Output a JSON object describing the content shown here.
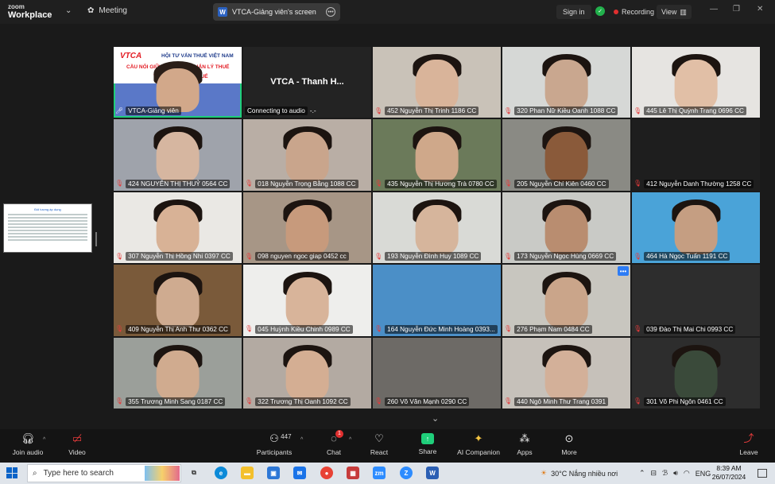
{
  "app": {
    "logo_line1": "zoom",
    "logo_line2": "Workplace",
    "meeting_label": "Meeting",
    "shared_screen_label": "VTCA-Giảng viên's screen",
    "sign_in": "Sign in",
    "recording": "Recording",
    "view": "View"
  },
  "slide_thumb_title": "Đối tượng áp dụng",
  "speaker_slide": {
    "logo": "VTCA",
    "line1": "HỘI TƯ VẤN THUẾ VIỆT NAM",
    "line2": "CẦU NỐI GIỮA CƠ QUAN QUẢN LÝ THUẾ",
    "line3": "VÀ NGƯỜI NỘP THUẾ"
  },
  "tiles": [
    {
      "name": "VTCA-Giảng viên",
      "type": "speaker"
    },
    {
      "name": "Connecting to audio",
      "big_name": "VTCA - Thanh H...",
      "type": "avatar"
    },
    {
      "name": "452 Nguyễn Thị Trinh 1186 CC"
    },
    {
      "name": "320 Phan Nữ Kiều Oanh 1088 CC"
    },
    {
      "name": "445 Lê Thị Quỳnh Trang 0696 CC"
    },
    {
      "name": "424 NGUYỄN THỊ THUỶ 0564 CC"
    },
    {
      "name": "018 Nguyễn Trọng Bằng 1088 CC"
    },
    {
      "name": "435 Nguyễn Thị Hương Trà 0780 CC"
    },
    {
      "name": "205 Nguyễn Chí Kiên 0460 CC"
    },
    {
      "name": "412 Nguyễn Danh Thường 1258 CC"
    },
    {
      "name": "307 Nguyễn Thị Hồng Nhi 0397 CC"
    },
    {
      "name": "098 nguyen ngoc giap 0452 cc"
    },
    {
      "name": "193 Nguyễn Đình Huy 1089 CC"
    },
    {
      "name": "173 Nguyễn Ngọc Hùng 0669 CC"
    },
    {
      "name": "464 Hà Ngọc Tuấn 1191 CC"
    },
    {
      "name": "409 Nguyễn Thị Anh Thư 0362 CC"
    },
    {
      "name": "045 Huỳnh Kiều Chinh 0989 CC"
    },
    {
      "name": "164 Nguyễn Đức Minh Hoàng 0393..."
    },
    {
      "name": "276 Phạm Nam 0484 CC"
    },
    {
      "name": "039 Đào Thị Mai Chi 0993 CC"
    },
    {
      "name": "355 Trương Minh Sang 0187 CC"
    },
    {
      "name": "322 Trương Thị Oanh 1092 CC"
    },
    {
      "name": "260 Võ Văn Mạnh 0290 CC"
    },
    {
      "name": "440 Ngô Minh Thư Trang 0391"
    },
    {
      "name": "301 Võ Phi Ngôn 0461 CC"
    }
  ],
  "toolbar": {
    "join_audio": "Join audio",
    "video": "Video",
    "participants": "Participants",
    "participant_count": "447",
    "chat": "Chat",
    "chat_badge": "1",
    "react": "React",
    "share": "Share",
    "ai_companion": "AI Companion",
    "apps": "Apps",
    "more": "More",
    "leave": "Leave"
  },
  "taskbar": {
    "search_placeholder": "Type here to search",
    "weather": "30°C  Nắng nhiều nơi",
    "lang": "ENG",
    "time": "8:39 AM",
    "date": "26/07/2024"
  }
}
